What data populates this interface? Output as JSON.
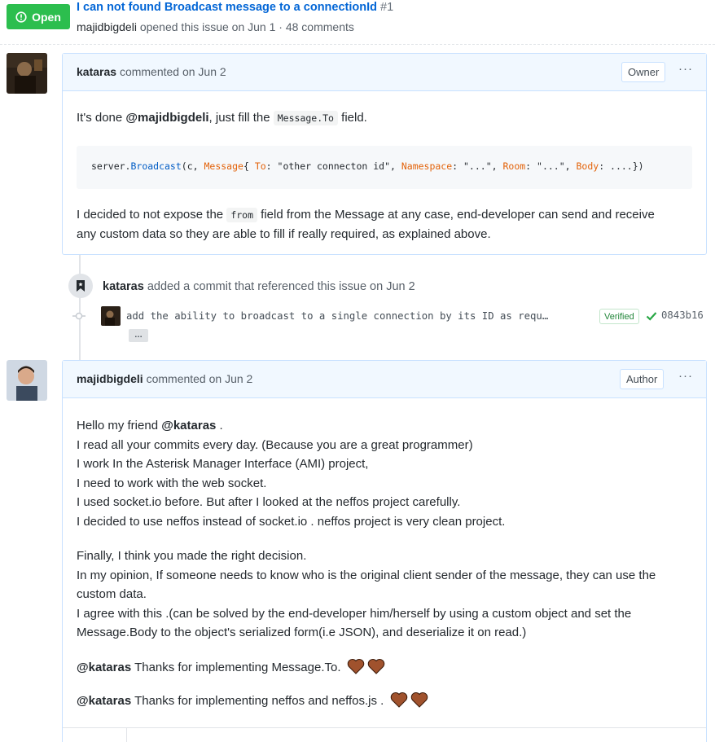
{
  "issue": {
    "state_label": "Open",
    "title": "I can not found Broadcast message to a connectionId",
    "number": "#1",
    "author": "majidbigdeli",
    "opened_text": "opened this issue on Jun 1 · 48 comments"
  },
  "comments": [
    {
      "author": "kataras",
      "commented_text": "commented on Jun 2",
      "role": "Owner",
      "menu": "···",
      "body": {
        "p1_before": "It's done ",
        "p1_mention": "@majidbigdeli",
        "p1_middle": ", just fill the ",
        "p1_code": "Message.To",
        "p1_after": " field.",
        "code": {
          "t1": "server.",
          "t2": "Broadcast",
          "t3": "(c, ",
          "t4": "Message",
          "t5": "{ ",
          "t6": "To",
          "t7": ": \"other connecton id\", ",
          "t8": "Namespace",
          "t9": ": \"...\", ",
          "t10": "Room",
          "t11": ": \"...\", ",
          "t12": "Body",
          "t13": ": ....})"
        },
        "p2_before": "I decided to not expose the ",
        "p2_code": "from",
        "p2_line1_after": " field from the Message at any case, end-developer can send and receive",
        "p2_line2": "any custom data so they are able to fill if really required, as explained above."
      }
    },
    {
      "author": "majidbigdeli",
      "commented_text": "commented on Jun 2",
      "role": "Author",
      "menu": "···",
      "body": {
        "l1_before": "Hello my friend ",
        "l1_mention": "@kataras",
        "l1_after": " .",
        "l2": "I read all your commits every day. (Because you are a great programmer)",
        "l3": "I work In the Asterisk Manager Interface (AMI) project,",
        "l4": "I need to work with the web socket.",
        "l5": "I used socket.io before. But after I looked at the neffos project carefully.",
        "l6": "I decided to use neffos instead of socket.io . neffos project is very clean project.",
        "l7": "Finally, I think you made the right decision.",
        "l8": "In my opinion, If someone needs to know who is the original client sender of the message, they can use the",
        "l9": "custom data.",
        "l10": "I agree with this .(can be solved by the end-developer him/herself by using a custom object and set the",
        "l11": "Message.Body to the object's serialized form(i.e JSON), and deserialize it on read.)",
        "t1_mention": "@kataras",
        "t1_text": " Thanks for implementing Message.To.",
        "t2_mention": "@kataras",
        "t2_text": " Thanks for implementing neffos and neffos.js ."
      }
    }
  ],
  "event": {
    "actor": "kataras",
    "text": "added a commit that referenced this issue on Jun 2",
    "commit_message": "add the ability to broadcast to a single connection by its ID as requ…",
    "ellipsis": "…",
    "verified_label": "Verified",
    "sha": "0843b16"
  },
  "colors": {
    "open_green": "#2cbe4e",
    "link_blue": "#0366d6",
    "comment_border": "#c8e1ff",
    "comment_header_bg": "#f1f8ff",
    "heart": "#a0522d"
  },
  "icons": [
    "issue-opened-icon",
    "bookmark-icon",
    "commit-node-icon",
    "check-icon",
    "heart-icon"
  ]
}
